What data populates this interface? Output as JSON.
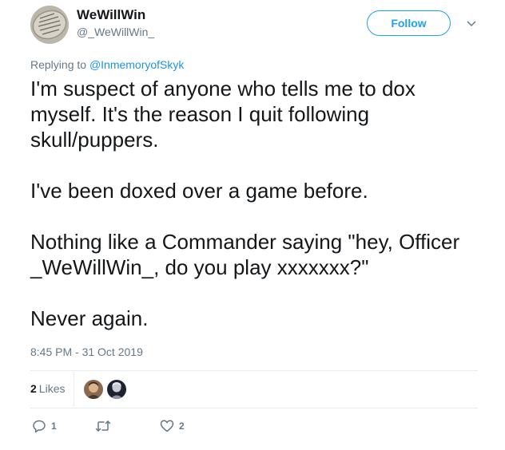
{
  "user": {
    "display_name": "WeWillWin",
    "handle": "@_WeWillWin_",
    "avatar_icon": "dog-tag-avatar"
  },
  "follow_label": "Follow",
  "replying": {
    "prefix": "Replying to ",
    "mention": "@InmemoryofSkyk"
  },
  "tweet": {
    "paragraphs": [
      "I'm suspect of anyone who tells me to dox myself. It's the reason I quit following skull/puppers.",
      "I've been doxed over a game before.",
      "Nothing like a Commander saying \"hey, Officer _WeWillWin_, do you play xxxxxxx?\"",
      "Never again."
    ],
    "timestamp": "8:45 PM - 31 Oct 2019"
  },
  "stats": {
    "likes_count": "2",
    "likes_label": "Likes"
  },
  "actions": {
    "reply_count": "1",
    "retweet_count": "",
    "like_count": "2"
  },
  "colors": {
    "accent": "#1da1f2",
    "link": "#1b95e0",
    "muted": "#657786",
    "text": "#14171a",
    "divider": "#e6ecf0"
  }
}
